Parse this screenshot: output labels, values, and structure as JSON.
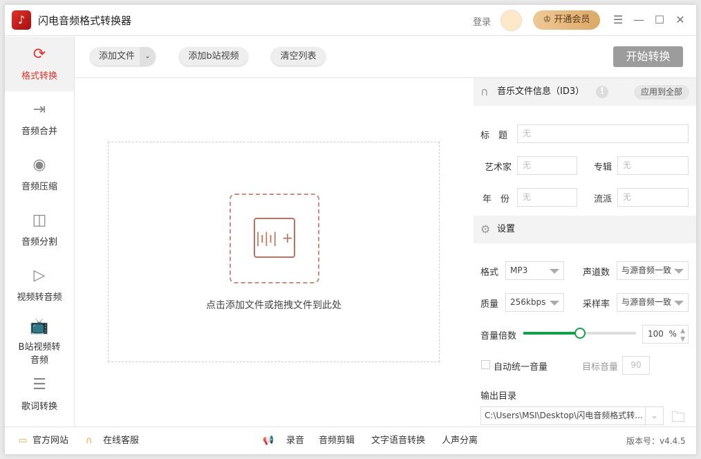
{
  "app": {
    "title": "闪电音频格式转换器",
    "login": "登录",
    "vip": "开通会员"
  },
  "sidebar": {
    "items": [
      {
        "label": "格式转换",
        "icon": "refresh-icon"
      },
      {
        "label": "音频合并",
        "icon": "merge-icon"
      },
      {
        "label": "音频压缩",
        "icon": "compress-icon"
      },
      {
        "label": "音频分割",
        "icon": "split-icon"
      },
      {
        "label": "视频转音频",
        "icon": "video-icon"
      },
      {
        "label": "B站视频转音频",
        "icon": "bilibili-icon"
      },
      {
        "label": "歌词转换",
        "icon": "lyrics-icon"
      }
    ]
  },
  "toolbar": {
    "add_file": "添加文件",
    "add_bili": "添加b站视频",
    "clear": "清空列表",
    "start": "开始转换"
  },
  "drop": {
    "hint": "点击添加文件或拖拽文件到此处"
  },
  "id3": {
    "header": "音乐文件信息（ID3）",
    "apply_all": "应用到全部",
    "title_label": "标　题",
    "artist_label": "艺术家",
    "album_label": "专辑",
    "year_label": "年　份",
    "genre_label": "流派",
    "placeholder": "无"
  },
  "settings": {
    "header": "设置",
    "format_label": "格式",
    "format": "MP3",
    "channels_label": "声道数",
    "channels": "与源音频一致",
    "quality_label": "质量",
    "quality": "256kbps",
    "samplerate_label": "采样率",
    "samplerate": "与源音频一致",
    "volume_label": "音量倍数",
    "volume": "100",
    "volume_unit": "%",
    "volume_fraction": 0.5,
    "auto_volume_label": "自动统一音量",
    "target_volume_label": "目标音量",
    "target_volume": "90",
    "output_label": "输出目录",
    "output_path": "C:\\Users\\MSI\\Desktop\\闪电音频格式转..."
  },
  "footer": {
    "website": "官方网站",
    "support": "在线客服",
    "record": "录音",
    "edit": "音频剪辑",
    "tts": "文字语音转换",
    "vocal": "人声分离",
    "version": "版本号：v4.4.5"
  },
  "colors": {
    "accent": "#e2342d",
    "slider": "#13a04a"
  }
}
